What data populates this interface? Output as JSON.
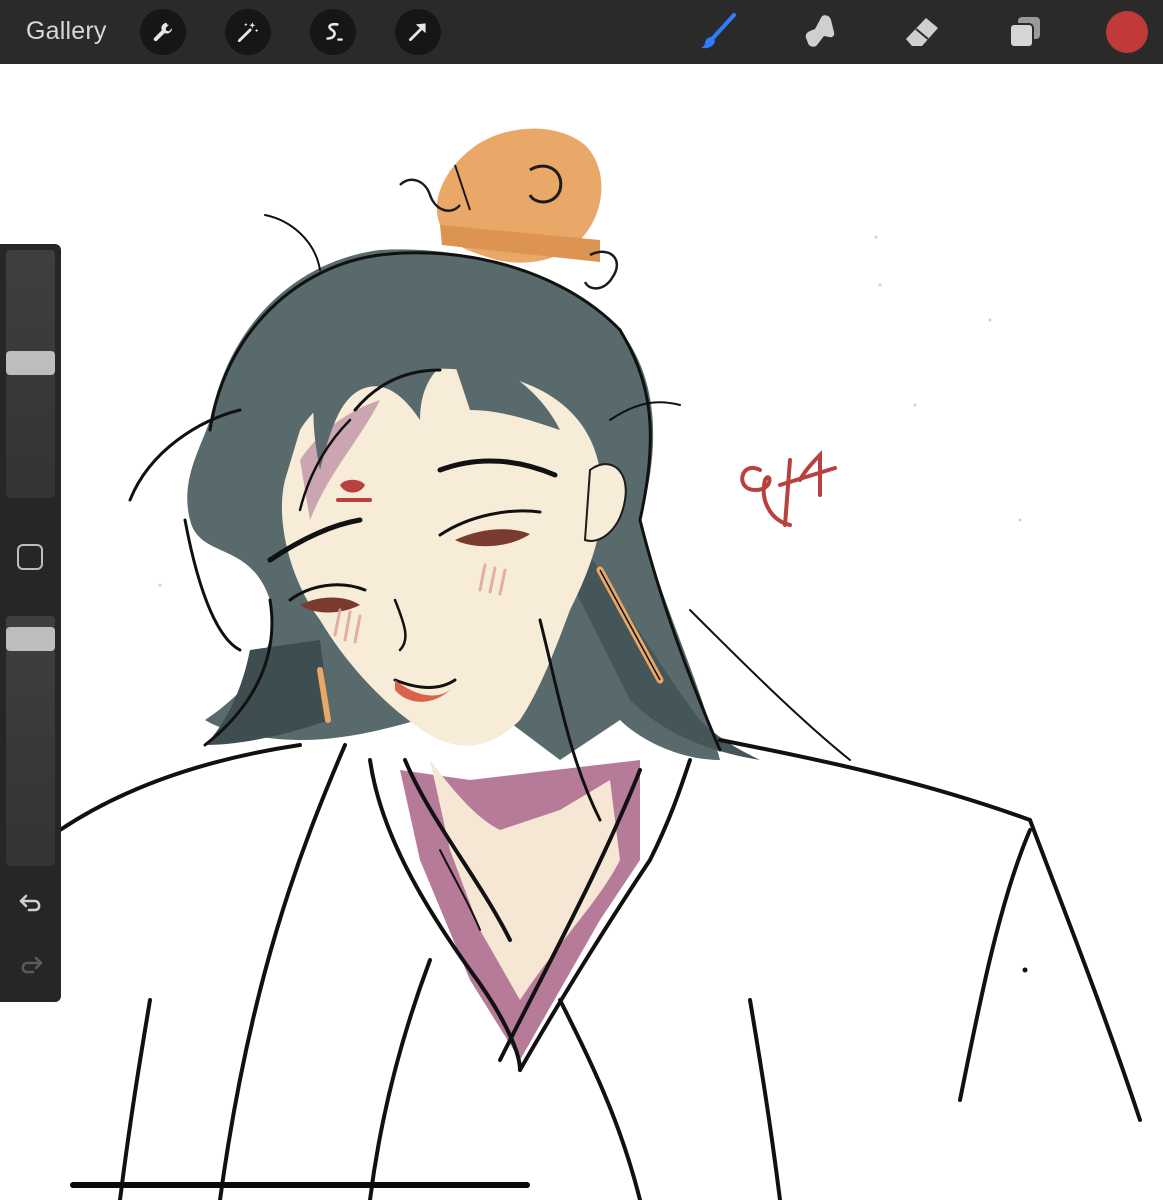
{
  "toolbar": {
    "gallery_label": "Gallery",
    "left_tools": [
      "wrench-icon",
      "magic-wand-icon",
      "selection-icon",
      "transform-arrow-icon"
    ],
    "right_tools": [
      "brush-icon",
      "smudge-icon",
      "eraser-icon",
      "layers-icon"
    ],
    "active_tool": "brush",
    "active_color": "#c03a3a",
    "brush_accent": "#2f7dff"
  },
  "sidebar": {
    "brush_size_level": 0.55,
    "opacity_level": 0.95,
    "controls": [
      "modify-button",
      "undo-icon",
      "redo-icon"
    ]
  },
  "canvas": {
    "background": "#ffffff",
    "signature_color": "#b8413f"
  }
}
